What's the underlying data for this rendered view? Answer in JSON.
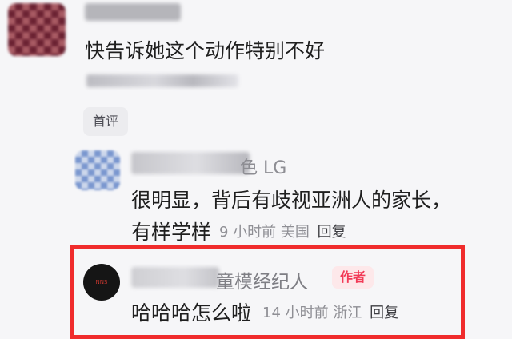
{
  "comment1": {
    "text": "快告诉她这个动作特别不好",
    "pin_tag": "首评"
  },
  "reply1": {
    "name_suffix": "色 LG",
    "text_line1": "很明显，背后有歧视亚洲人的家长，",
    "text_line2": "有样学样",
    "time": "9 小时前",
    "location": "美国",
    "reply_label": "回复"
  },
  "reply2": {
    "avatar_text": "NNS",
    "name_suffix": "童模经纪人",
    "author_badge": "作者",
    "text": "哈哈哈怎么啦",
    "time": "14 小时前",
    "location": "浙江",
    "reply_label": "回复",
    "highlight_color": "#f02c2c"
  }
}
